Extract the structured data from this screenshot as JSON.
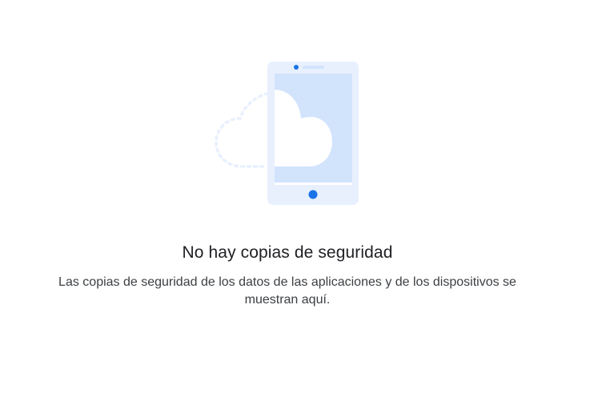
{
  "empty_state": {
    "illustration_icon": "phone-cloud-backup-icon",
    "title": "No hay copias de seguridad",
    "description": "Las copias de seguridad de los datos de las aplicaciones y de los dispositivos se muestran aquí."
  },
  "colors": {
    "phone_frame": "#e8f0fe",
    "phone_screen": "#d2e3fc",
    "accent_blue": "#1a73e8",
    "dashed_cloud": "#e8f0fe",
    "cloud_fill": "#ffffff",
    "title_text": "#202124",
    "description_text": "#3c4043"
  }
}
